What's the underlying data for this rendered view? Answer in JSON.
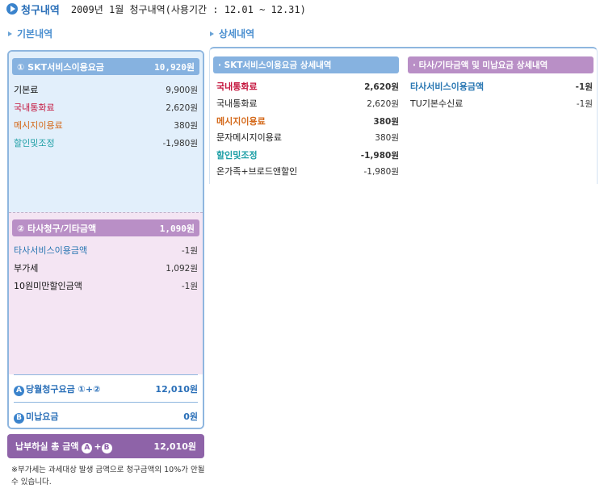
{
  "header": {
    "title": "청구내역",
    "period": "2009년 1월 청구내역(사용기간 : 12.01 ~ 12.31)"
  },
  "basic": {
    "label": "기본내역",
    "skt": {
      "title": "① SKT서비스이용요금",
      "amount": "10,920원",
      "items": [
        {
          "label": "기본료",
          "amount": "9,900원"
        },
        {
          "label": "국내통화료",
          "amount": "2,620원"
        },
        {
          "label": "메시지이용료",
          "amount": "380원"
        },
        {
          "label": "할인및조정",
          "amount": "-1,980원"
        }
      ]
    },
    "other": {
      "title": "② 타사청구/기타금액",
      "amount": "1,090원",
      "items": [
        {
          "label": "타사서비스이용금액",
          "amount": "-1원"
        },
        {
          "label": "부가세",
          "amount": "1,092원"
        },
        {
          "label": "10원미만할인금액",
          "amount": "-1원"
        }
      ]
    },
    "current": {
      "badge": "A",
      "label": "당월청구요금 ①+②",
      "amount": "12,010원"
    },
    "unpaid": {
      "badge": "B",
      "label": "미납요금",
      "amount": "0원"
    },
    "total": {
      "label_pre": "납부하실 총 금액",
      "badge_a": "A",
      "plus": "+",
      "badge_b": "B",
      "amount": "12,010원"
    },
    "note": "※부가세는 과세대상 발생 금액으로 청구금액의 10%가 안될 수 있습니다."
  },
  "detail": {
    "label": "상세내역",
    "skt": {
      "title": "· SKT서비스이용요금 상세내역",
      "groups": [
        {
          "label": "국내통화료",
          "amount": "2,620원",
          "sub": [
            {
              "label": "국내통화료",
              "amount": "2,620원"
            }
          ]
        },
        {
          "label": "메시지이용료",
          "amount": "380원",
          "sub": [
            {
              "label": "문자메시지이용료",
              "amount": "380원"
            }
          ]
        },
        {
          "label": "할인및조정",
          "amount": "-1,980원",
          "sub": [
            {
              "label": "온가족+브로드앤할인",
              "amount": "-1,980원"
            }
          ]
        }
      ]
    },
    "other": {
      "title": "· 타사/기타금액 및 미납요금 상세내역",
      "groups": [
        {
          "label": "타사서비스이용금액",
          "amount": "-1원",
          "sub": [
            {
              "label": "TU기본수신료",
              "amount": "-1원"
            }
          ]
        }
      ]
    }
  },
  "colors": {
    "accent_blue": "#3a83cc",
    "bar_blue": "#86b2e0",
    "bar_purple": "#b98fc6",
    "total_purple": "#8e63a8",
    "red": "#c4143c",
    "orange": "#d4691a",
    "teal": "#1e9fa6"
  }
}
